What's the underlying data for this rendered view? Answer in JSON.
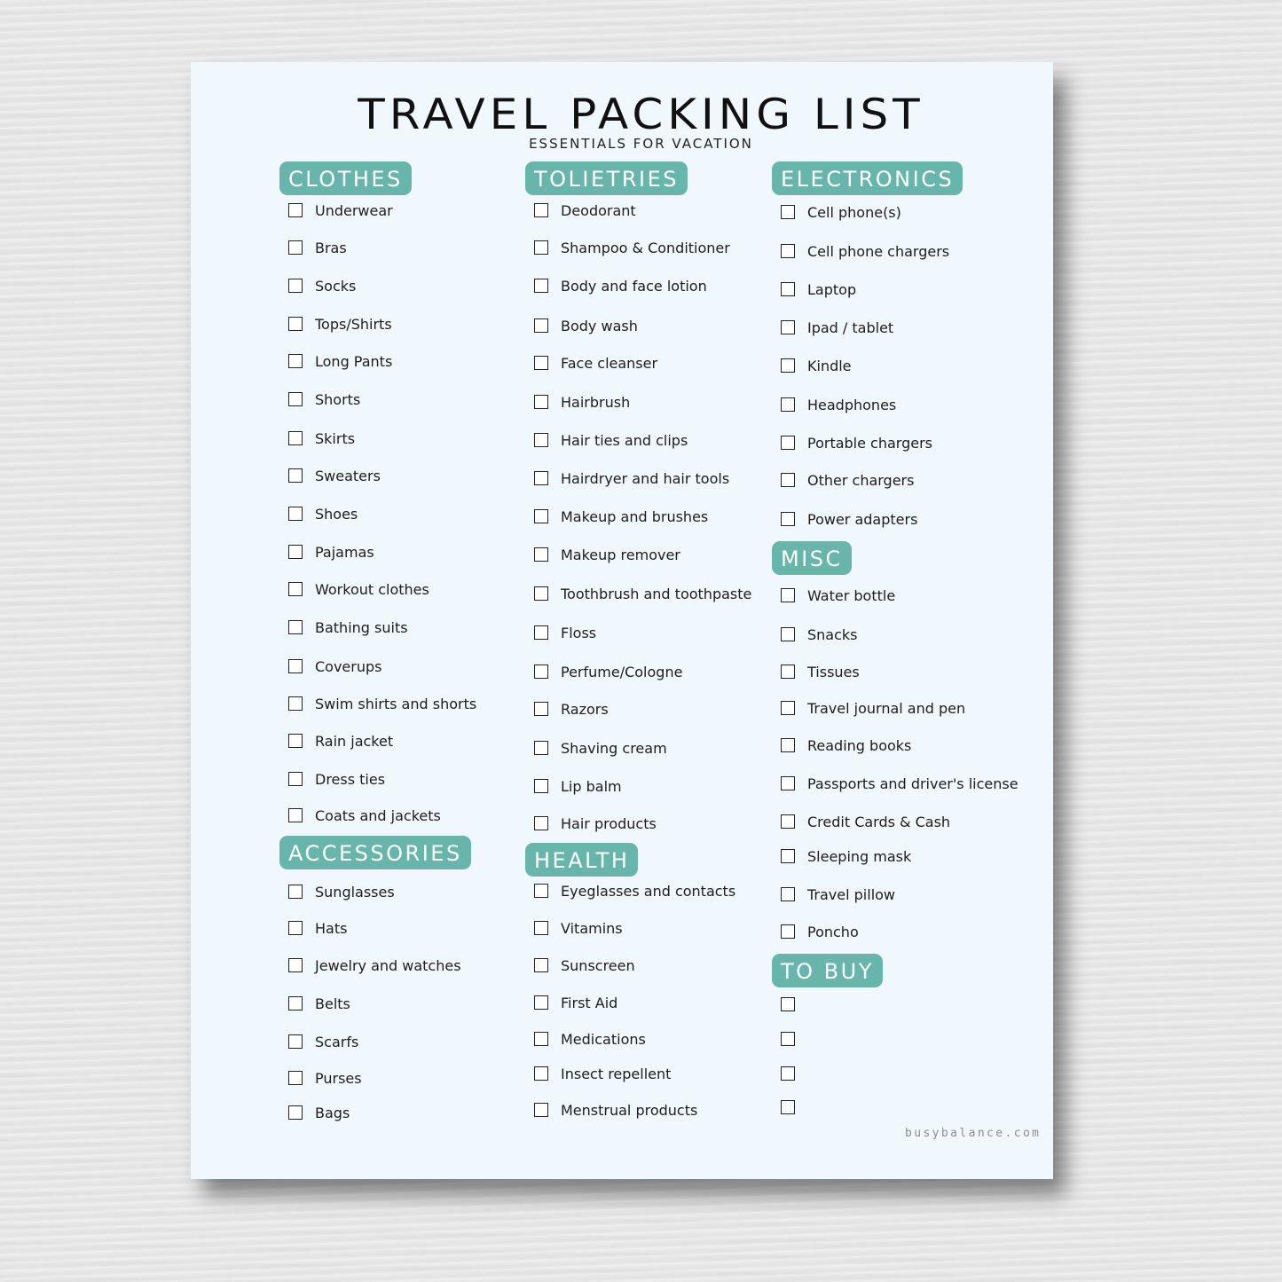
{
  "title": "TRAVEL PACKING LIST",
  "subtitle": "ESSENTIALS FOR VACATION",
  "accent_color": "#68b6ab",
  "footer": "busybalance.com",
  "sections": {
    "clothes": {
      "heading": "CLOTHES",
      "items": [
        "Underwear",
        "Bras",
        "Socks",
        "Tops/Shirts",
        "Long Pants",
        "Shorts",
        "Skirts",
        "Sweaters",
        "Shoes",
        "Pajamas",
        "Workout clothes",
        "Bathing suits",
        "Coverups",
        "Swim shirts and shorts",
        "Rain jacket",
        "Dress ties",
        "Coats and jackets"
      ]
    },
    "accessories": {
      "heading": "ACCESSORIES",
      "items": [
        "Sunglasses",
        "Hats",
        "Jewelry and watches",
        "Belts",
        "Scarfs",
        "Purses",
        "Bags"
      ]
    },
    "toiletries": {
      "heading": "TOLIETRIES",
      "items": [
        "Deodorant",
        "Shampoo & Conditioner",
        "Body and face lotion",
        "Body wash",
        "Face cleanser",
        "Hairbrush",
        "Hair ties and clips",
        "Hairdryer and hair tools",
        "Makeup and brushes",
        "Makeup remover",
        "Toothbrush and toothpaste",
        "Floss",
        "Perfume/Cologne",
        "Razors",
        "Shaving cream",
        "Lip balm",
        "Hair products"
      ]
    },
    "health": {
      "heading": "HEALTH",
      "items": [
        "Eyeglasses and contacts",
        "Vitamins",
        "Sunscreen",
        "First Aid",
        "Medications",
        "Insect repellent",
        "Menstrual products"
      ]
    },
    "electronics": {
      "heading": "ELECTRONICS",
      "items": [
        "Cell phone(s)",
        "Cell phone chargers",
        "Laptop",
        "Ipad / tablet",
        "Kindle",
        "Headphones",
        "Portable chargers",
        "Other chargers",
        "Power adapters"
      ]
    },
    "misc": {
      "heading": "MISC",
      "items": [
        "Water bottle",
        "Snacks",
        "Tissues",
        "Travel journal and pen",
        "Reading books",
        "Passports and driver's license",
        "Credit Cards & Cash",
        "Sleeping mask",
        "Travel pillow",
        "Poncho"
      ]
    },
    "to_buy": {
      "heading": "TO BUY",
      "items": [
        "",
        "",
        "",
        ""
      ]
    }
  }
}
